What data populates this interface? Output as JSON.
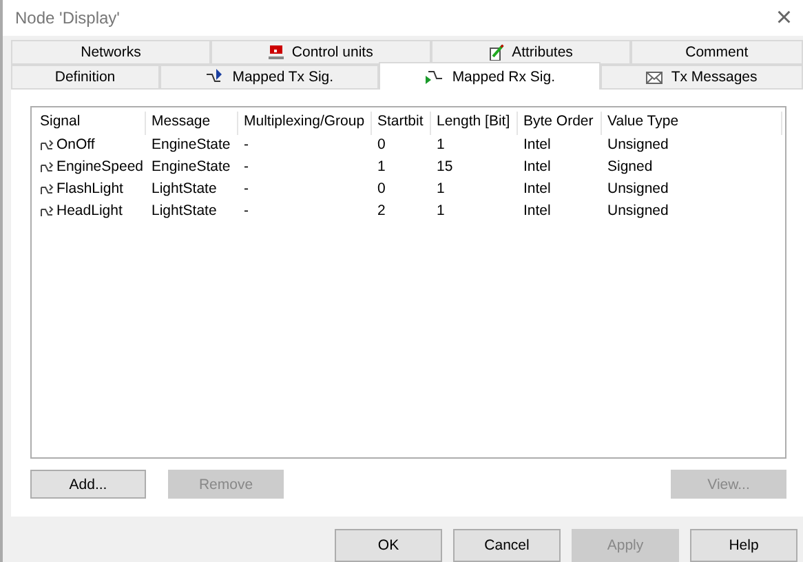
{
  "window": {
    "title": "Node 'Display'",
    "close": "×"
  },
  "tab_rows": [
    [
      {
        "label": "Networks",
        "selected": false
      },
      {
        "label": "Control units",
        "selected": false
      },
      {
        "label": "Attributes",
        "selected": false
      },
      {
        "label": "Comment",
        "selected": false
      }
    ],
    [
      {
        "label": "Definition",
        "selected": false
      },
      {
        "label": "Mapped Tx Sig.",
        "selected": false
      },
      {
        "label": "Mapped Rx Sig.",
        "selected": true
      },
      {
        "label": "Tx Messages",
        "selected": false
      }
    ]
  ],
  "table": {
    "columns": [
      "Signal",
      "Message",
      "Multiplexing/Group",
      "Startbit",
      "Length [Bit]",
      "Byte Order",
      "Value Type"
    ],
    "rows": [
      [
        "OnOff",
        "EngineState",
        "-",
        "0",
        "1",
        "Intel",
        "Unsigned"
      ],
      [
        "EngineSpeed",
        "EngineState",
        "-",
        "1",
        "15",
        "Intel",
        "Signed"
      ],
      [
        "FlashLight",
        "LightState",
        "-",
        "0",
        "1",
        "Intel",
        "Unsigned"
      ],
      [
        "HeadLight",
        "LightState",
        "-",
        "2",
        "1",
        "Intel",
        "Unsigned"
      ]
    ]
  },
  "panel_buttons": [
    {
      "label": "Add...",
      "disabled": false
    },
    {
      "label": "Remove",
      "disabled": true
    },
    {
      "label": "View...",
      "disabled": true
    }
  ],
  "dialog_buttons": [
    {
      "label": "OK",
      "disabled": false
    },
    {
      "label": "Cancel",
      "disabled": false
    },
    {
      "label": "Apply",
      "disabled": true
    },
    {
      "label": "Help",
      "disabled": false
    }
  ]
}
